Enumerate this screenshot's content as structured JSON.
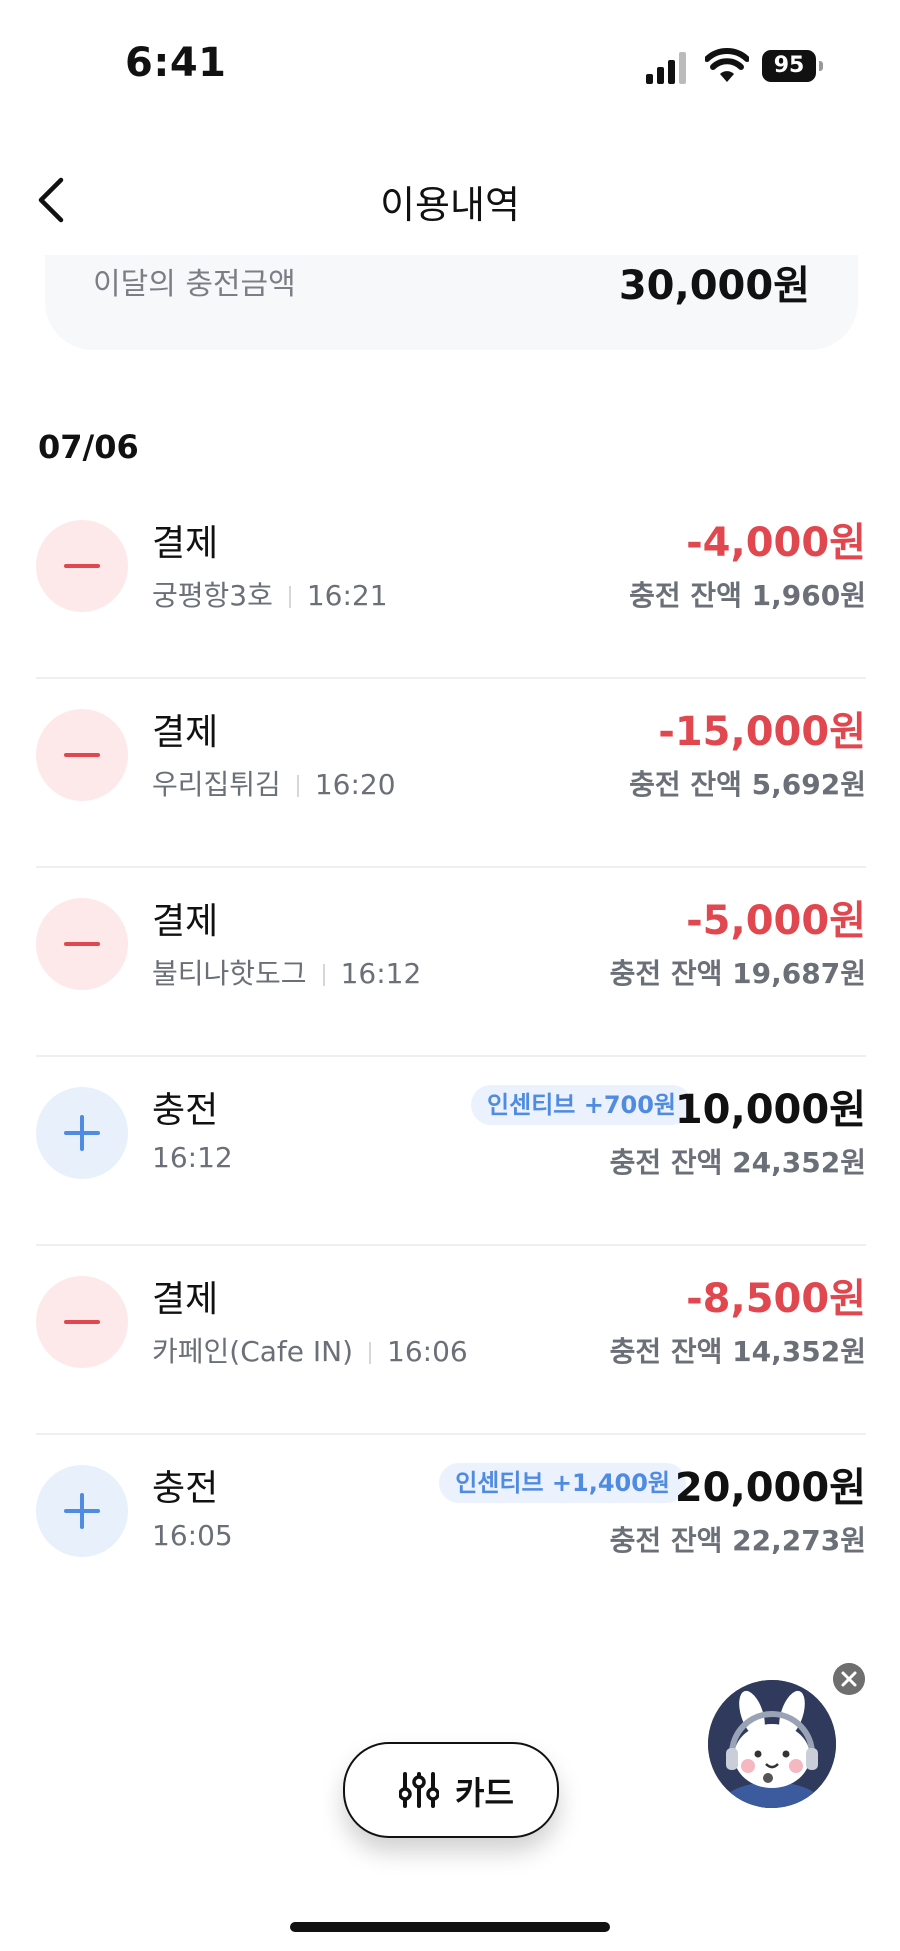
{
  "status_bar": {
    "time": "6:41",
    "battery": "95"
  },
  "header": {
    "title": "이용내역"
  },
  "summary": {
    "label": "이달의 충전금액",
    "value": "30,000원"
  },
  "date_header": "07/06",
  "transactions": [
    {
      "type": "payment",
      "title": "결제",
      "merchant": "궁평항3호",
      "time": "16:21",
      "amount": "-4,000원",
      "balance": "충전 잔액 1,960원"
    },
    {
      "type": "payment",
      "title": "결제",
      "merchant": "우리집튀김",
      "time": "16:20",
      "amount": "-15,000원",
      "balance": "충전 잔액 5,692원"
    },
    {
      "type": "payment",
      "title": "결제",
      "merchant": "불티나핫도그",
      "time": "16:12",
      "amount": "-5,000원",
      "balance": "충전 잔액 19,687원"
    },
    {
      "type": "charge",
      "title": "충전",
      "time": "16:12",
      "incentive": "인센티브 +700원",
      "amount": "10,000원",
      "balance": "충전 잔액 24,352원"
    },
    {
      "type": "payment",
      "title": "결제",
      "merchant": "카페인(Cafe IN)",
      "time": "16:06",
      "amount": "-8,500원",
      "balance": "충전 잔액 14,352원"
    },
    {
      "type": "charge",
      "title": "충전",
      "time": "16:05",
      "incentive": "인센티브 +1,400원",
      "amount": "20,000원",
      "balance": "충전 잔액 22,273원"
    }
  ],
  "filter_button": {
    "label": "카드",
    "icon": "sliders-icon"
  },
  "colors": {
    "negative": "#e0474f",
    "positive_accent": "#4f8be0",
    "muted": "#6b7078"
  }
}
